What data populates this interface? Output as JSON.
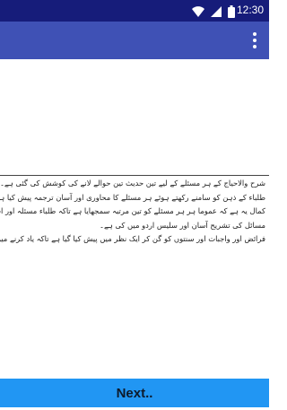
{
  "status_bar": {
    "time": "12:30",
    "icons": [
      "wifi-icon",
      "signal-icon",
      "battery-icon"
    ]
  },
  "content": {
    "paragraphs": [
      "شرح والاحیاج کے ہر مسئلے کے لیے تین حدیث تین حوالے لانے کی کوشش کی گئی ہے۔اوراس کا پورا حوالہ دیا گیا ہے،",
      "طلباء کے ذہن کو سامنے رکھتے ہوئے ہر مسئلے کا محاوری اور آسان ترجمہ پیش کیا ہے۔",
      "کمال یہ ہے کہ عموما ہر ہر مسئلے کو تین مرتبہ سمجھایا ہے تاکہ طلباء مسئلہ اور اسکی دلیل بھی آسانی سے سمجھ جائیں",
      "مسائل کی تشریح آسان اور سلیس اردو میں کی ہے۔",
      "فرائض اور واجبات اور سنتوں کو گن کر ایک نظر میں پیش کیا گیا ہے تاکہ یاد کرنے میں آسانی ہو"
    ]
  },
  "footer": {
    "next_label": "Next.."
  }
}
